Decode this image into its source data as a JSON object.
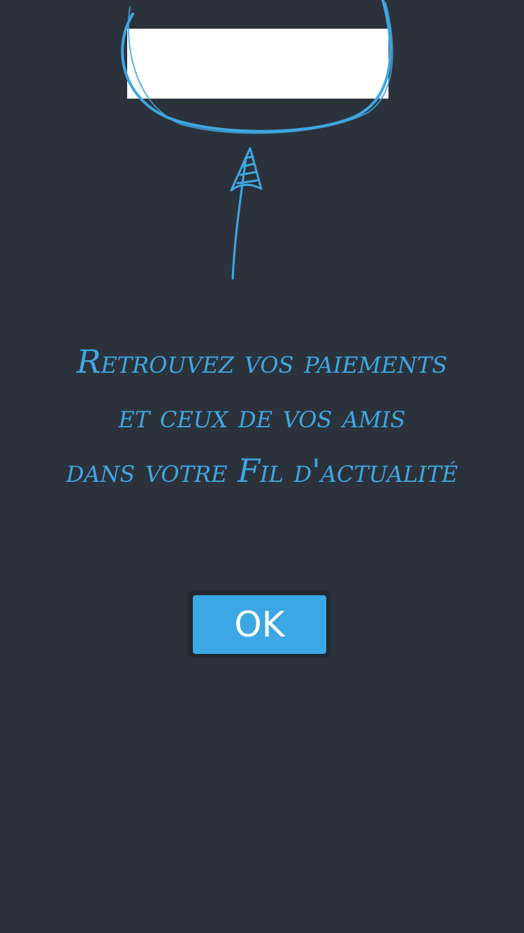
{
  "tooltip": {
    "message_lines": [
      "Retrouvez vos paiements",
      "et ceux de vos amis",
      "dans votre Fil d'actualité"
    ],
    "ok_label": "OK"
  },
  "colors": {
    "background": "#2b323c",
    "accent": "#3ba7e4",
    "highlight_fill": "#ffffff"
  },
  "icons": {
    "arrow": "hand-drawn-arrow-up-icon",
    "circle": "hand-drawn-circle-highlight"
  }
}
